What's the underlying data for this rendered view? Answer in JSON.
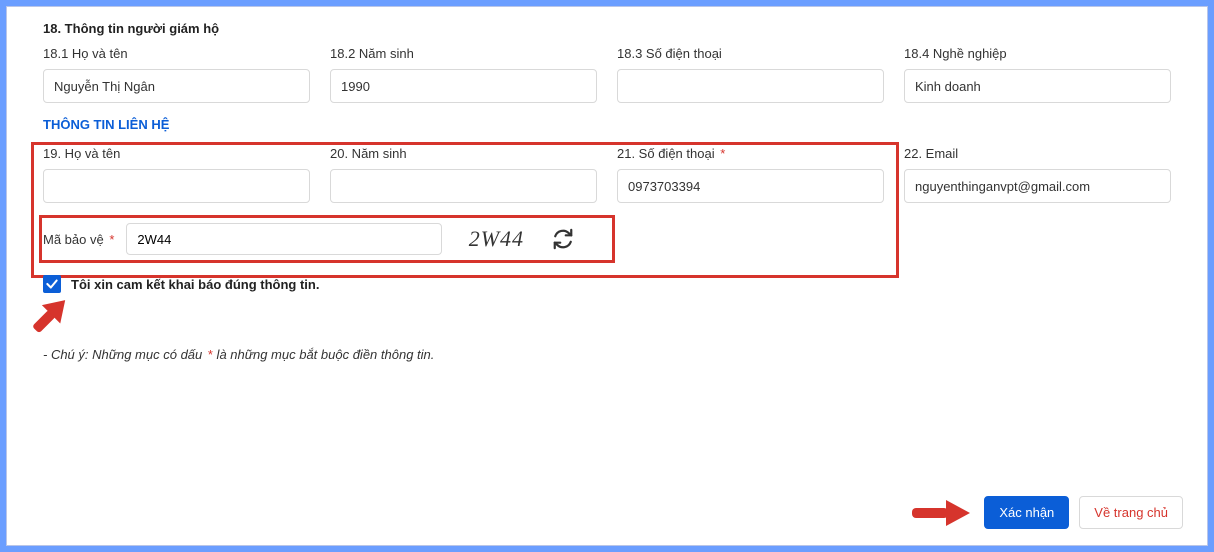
{
  "section18": {
    "title": "18. Thông tin người giám hộ",
    "fields": {
      "fullname": {
        "label": "18.1 Họ và tên",
        "value": "Nguyễn Thị Ngân"
      },
      "birthyear": {
        "label": "18.2 Năm sinh",
        "value": "1990"
      },
      "phone": {
        "label": "18.3 Số điện thoại",
        "value": ""
      },
      "job": {
        "label": "18.4 Nghề nghiệp",
        "value": "Kinh doanh"
      }
    }
  },
  "contact": {
    "title": "THÔNG TIN LIÊN HỆ",
    "fields": {
      "fullname": {
        "label": "19. Họ và tên",
        "value": ""
      },
      "birthyear": {
        "label": "20. Năm sinh",
        "value": ""
      },
      "phone": {
        "label": "21. Số điện thoại",
        "value": "0973703394",
        "required": true
      },
      "email": {
        "label": "22. Email",
        "value": "nguyenthinganvpt@gmail.com"
      }
    }
  },
  "captcha": {
    "label": "Mã bảo vệ",
    "required": true,
    "value": "2W44",
    "image_text": "2W44"
  },
  "commitment": {
    "checked": true,
    "text": "Tôi xin cam kết khai báo đúng thông tin."
  },
  "note": {
    "prefix": "- Chú ý: Những mục có dấu ",
    "star": "*",
    "suffix": " là những mục bắt buộc điền thông tin."
  },
  "buttons": {
    "confirm": "Xác nhận",
    "home": "Về trang chủ"
  }
}
